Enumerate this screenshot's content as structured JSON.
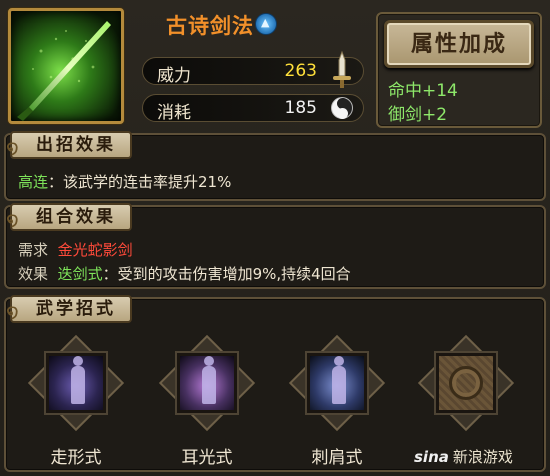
{
  "skill": {
    "name": "古诗剑法",
    "icon": "glowing-sword-icon",
    "power_label": "威力",
    "power_value": "263",
    "cost_label": "消耗",
    "cost_value": "185"
  },
  "attributes": {
    "button_label": "属性加成",
    "lines": [
      "命中+14",
      "御剑+2"
    ]
  },
  "effect_section": {
    "title": "出招效果",
    "keyword": "高连",
    "text": "：该武学的连击率提升21%"
  },
  "combo_section": {
    "title": "组合效果",
    "require_label": "需求",
    "require_value": "金光蛇影剑",
    "effect_label": "效果",
    "effect_keyword": "迭剑式",
    "effect_text": "：受到的攻击伤害增加9%,持续4回合"
  },
  "moves_section": {
    "title": "武学招式",
    "moves": [
      {
        "label": "走形式"
      },
      {
        "label": "耳光式"
      },
      {
        "label": "刺肩式"
      },
      {
        "label": ""
      }
    ]
  },
  "watermark": {
    "logo": "sina",
    "text": "新浪游戏"
  },
  "colors": {
    "skill_name": "#f2902a",
    "power_value": "#ffe03a",
    "attribute_green": "#8ee86a",
    "keyword_green": "#7ee35a",
    "require_red": "#ff4a3a",
    "panel_border": "#5e5038"
  }
}
